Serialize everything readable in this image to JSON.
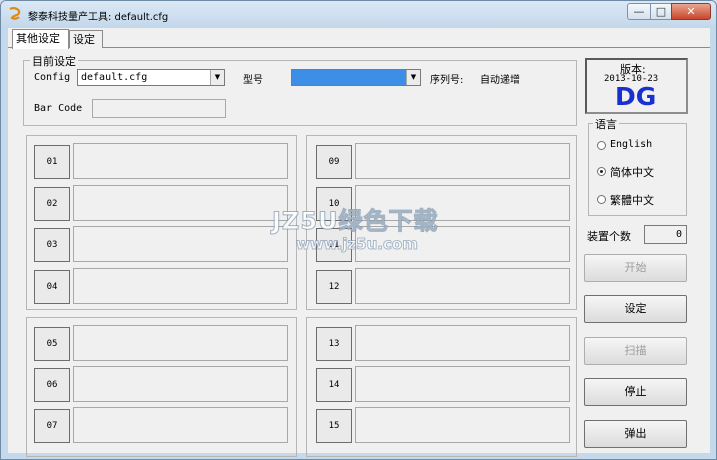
{
  "window": {
    "title": "黎泰科技量产工具: default.cfg",
    "controls": {
      "minimize": "—",
      "maximize": "□",
      "close": "✕"
    }
  },
  "tabs": [
    {
      "label": "其他设定",
      "active": true
    },
    {
      "label": "设定",
      "active": false
    }
  ],
  "settings_group": {
    "legend": "目前设定",
    "config_label": "Config",
    "config_value": "default.cfg",
    "model_label": "型号",
    "model_value": "",
    "serial_label": "序列号:",
    "serial_value": "自动递增",
    "barcode_label": "Bar Code",
    "barcode_value": ""
  },
  "slots": [
    "01",
    "02",
    "03",
    "04",
    "05",
    "06",
    "07",
    "09",
    "10",
    "11",
    "12",
    "13",
    "14",
    "15"
  ],
  "version": {
    "label": "版本:",
    "date": "2013-10-23",
    "brand": "DG",
    "brand_color": "#1a2fd0"
  },
  "language": {
    "legend": "语言",
    "options": [
      {
        "label": "English",
        "selected": false
      },
      {
        "label": "简体中文",
        "selected": true
      },
      {
        "label": "繁體中文",
        "selected": false
      }
    ]
  },
  "device_count": {
    "label": "装置个数",
    "value": "0"
  },
  "buttons": {
    "start": {
      "label": "开始",
      "enabled": false
    },
    "settings": {
      "label": "设定",
      "enabled": true
    },
    "scan": {
      "label": "扫描",
      "enabled": false
    },
    "stop": {
      "label": "停止",
      "enabled": true
    },
    "eject": {
      "label": "弹出",
      "enabled": true
    }
  },
  "watermark": {
    "line1": "JZ5U绿色下载",
    "line2": "www.jz5u.com"
  }
}
